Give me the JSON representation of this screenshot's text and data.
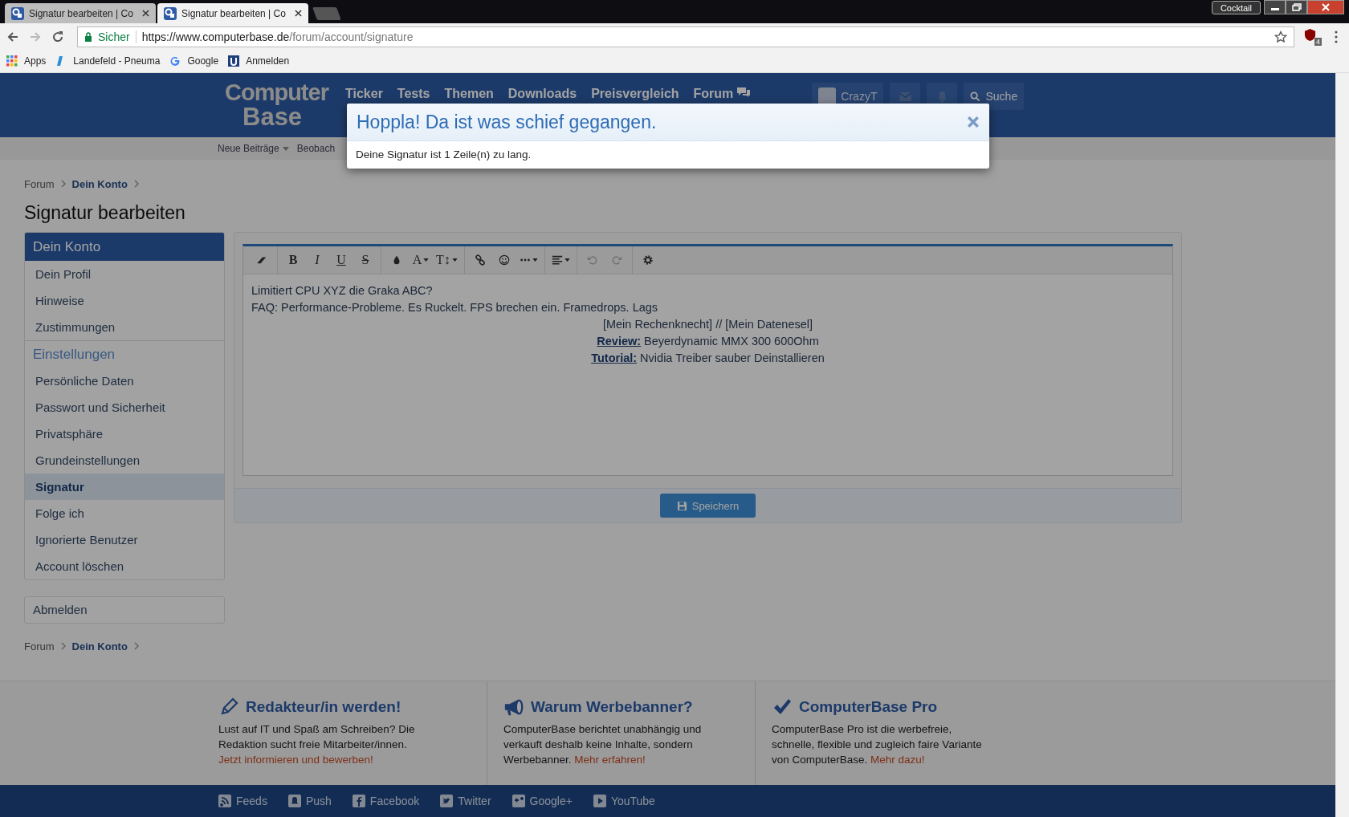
{
  "browser": {
    "tabs": [
      {
        "title": "Signatur bearbeiten | Co",
        "selected": false
      },
      {
        "title": "Signatur bearbeiten | Co",
        "selected": true
      }
    ],
    "profile": "Cocktail",
    "address": {
      "security": "Sicher",
      "host": "https://www.computerbase.de",
      "path": "/forum/account/signature"
    },
    "extension_badge": "4",
    "bookmarks": [
      {
        "label": "Apps",
        "kind": "apps"
      },
      {
        "label": "Landefeld - Pneuma",
        "kind": "letter"
      },
      {
        "label": "Google",
        "kind": "google"
      },
      {
        "label": "Anmelden",
        "kind": "square"
      }
    ]
  },
  "site_header": {
    "logo": [
      "Computer",
      "Base"
    ],
    "nav": [
      {
        "label": "Ticker",
        "chat": false
      },
      {
        "label": "Tests",
        "chat": false
      },
      {
        "label": "Themen",
        "chat": false
      },
      {
        "label": "Downloads",
        "chat": false
      },
      {
        "label": "Preisvergleich",
        "chat": false
      },
      {
        "label": "Forum",
        "chat": true
      }
    ],
    "user": "CrazyT",
    "search": "Suche"
  },
  "subnav": [
    {
      "label": "Neue Beiträge",
      "dropdown": true
    },
    {
      "label": "Beobach",
      "dropdown": false
    }
  ],
  "breadcrumb": [
    {
      "label": "Forum",
      "current": false
    },
    {
      "label": "Dein Konto",
      "current": true
    }
  ],
  "page_title": "Signatur bearbeiten",
  "sidebar": {
    "groups": [
      {
        "title": "Dein Konto",
        "kind": "header",
        "items": [
          {
            "label": "Dein Profil",
            "selected": false
          },
          {
            "label": "Hinweise",
            "selected": false
          },
          {
            "label": "Zustimmungen",
            "selected": false
          }
        ]
      },
      {
        "title": "Einstellungen",
        "kind": "section",
        "items": [
          {
            "label": "Persönliche Daten",
            "selected": false
          },
          {
            "label": "Passwort und Sicherheit",
            "selected": false
          },
          {
            "label": "Privatsphäre",
            "selected": false
          },
          {
            "label": "Grundeinstellungen",
            "selected": false
          },
          {
            "label": "Signatur",
            "selected": true
          },
          {
            "label": "Folge ich",
            "selected": false
          },
          {
            "label": "Ignorierte Benutzer",
            "selected": false
          },
          {
            "label": "Account löschen",
            "selected": false
          }
        ]
      }
    ],
    "logout": "Abmelden"
  },
  "editor": {
    "toolbar": [
      {
        "buttons": [
          {
            "kind": "eraser",
            "dropdown": false,
            "disabled": false
          }
        ]
      },
      {
        "buttons": [
          {
            "kind": "bold",
            "label": "B",
            "dropdown": false,
            "disabled": false
          },
          {
            "kind": "italic",
            "label": "I",
            "dropdown": false,
            "disabled": false
          },
          {
            "kind": "underline",
            "label": "U",
            "dropdown": false,
            "disabled": false
          },
          {
            "kind": "strike",
            "label": "S",
            "dropdown": false,
            "disabled": false
          }
        ]
      },
      {
        "buttons": [
          {
            "kind": "drop",
            "dropdown": false,
            "disabled": false
          },
          {
            "kind": "letter",
            "label": "A",
            "dropdown": true,
            "disabled": false
          },
          {
            "kind": "letter",
            "label": "T↕",
            "dropdown": true,
            "disabled": false
          }
        ]
      },
      {
        "buttons": [
          {
            "kind": "link",
            "dropdown": false,
            "disabled": false
          },
          {
            "kind": "smiley",
            "dropdown": false,
            "disabled": false
          },
          {
            "kind": "dots",
            "dropdown": true,
            "disabled": false
          }
        ]
      },
      {
        "buttons": [
          {
            "kind": "align",
            "dropdown": true,
            "disabled": false
          }
        ]
      },
      {
        "buttons": [
          {
            "kind": "undo",
            "dropdown": false,
            "disabled": true
          },
          {
            "kind": "redo",
            "dropdown": false,
            "disabled": true
          }
        ]
      },
      {
        "buttons": [
          {
            "kind": "gear",
            "dropdown": false,
            "disabled": false
          }
        ]
      }
    ],
    "lines": [
      {
        "centered": false,
        "parts": [
          {
            "kind": "text",
            "text": "Limitiert CPU XYZ die Graka ABC?"
          }
        ]
      },
      {
        "centered": false,
        "parts": [
          {
            "kind": "text",
            "text": "FAQ: Performance-Probleme. Es Ruckelt. FPS brechen ein. Framedrops. Lags"
          }
        ]
      },
      {
        "centered": true,
        "parts": [
          {
            "kind": "text",
            "text": "[Mein Rechenknecht] // [Mein Datenesel]"
          }
        ]
      },
      {
        "centered": true,
        "parts": [
          {
            "kind": "link",
            "text": "Review:"
          },
          {
            "kind": "text",
            "text": " Beyerdynamic MMX 300 600Ohm"
          }
        ]
      },
      {
        "centered": true,
        "parts": [
          {
            "kind": "link",
            "text": "Tutorial:"
          },
          {
            "kind": "text",
            "text": " Nvidia Treiber sauber Deinstallieren"
          }
        ]
      }
    ],
    "save_button": "Speichern"
  },
  "bottom_breadcrumb": [
    {
      "label": "Forum",
      "current": false
    },
    {
      "label": "Dein Konto",
      "current": true
    }
  ],
  "footer": {
    "columns": [
      {
        "kind": "pencil",
        "title": "Redakteur/in werden!",
        "text": "Lust auf IT und Spaß am Schreiben? Die Redaktion sucht freie Mitarbeiter/innen.",
        "link": "Jetzt informieren und bewerben!"
      },
      {
        "kind": "megaphone",
        "title": "Warum Werbebanner?",
        "text": "ComputerBase berichtet unabhängig und verkauft deshalb keine Inhalte, sondern Werbebanner.",
        "link": "Mehr erfahren!"
      },
      {
        "kind": "check",
        "title": "ComputerBase Pro",
        "text": "ComputerBase Pro ist die werbefreie, schnelle, flexible und zugleich faire Variante von ComputerBase.",
        "link": "Mehr dazu!"
      }
    ],
    "social": [
      {
        "label": "Feeds",
        "kind": "rss"
      },
      {
        "label": "Push",
        "kind": "bell"
      },
      {
        "label": "Facebook",
        "kind": "f"
      },
      {
        "label": "Twitter",
        "kind": "bird"
      },
      {
        "label": "Google+",
        "kind": "g"
      },
      {
        "label": "YouTube",
        "kind": "play"
      }
    ]
  },
  "modal": {
    "title": "Hoppla! Da ist was schief gegangen.",
    "message": "Deine Signatur ist 1 Zeile(n) zu lang."
  }
}
